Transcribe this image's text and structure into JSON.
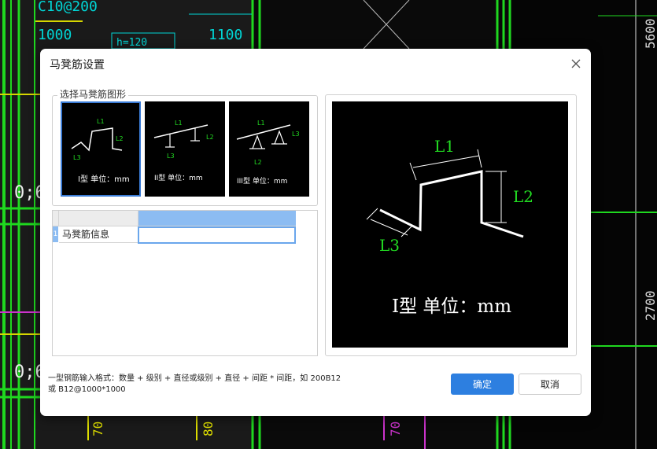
{
  "background": {
    "labels": [
      "C10@200",
      "1000",
      "1100",
      "h=120",
      "5600",
      "2700",
      "0;6",
      "0;6",
      "70",
      "80",
      "70"
    ]
  },
  "dialog": {
    "title": "马凳筋设置",
    "group_label": "选择马凳筋图形",
    "shapes": [
      {
        "caption": "I型 单位：mm",
        "selected": true,
        "labels": [
          "L1",
          "L2",
          "L3"
        ]
      },
      {
        "caption": "II型 单位：mm",
        "selected": false,
        "labels": [
          "L1",
          "L2",
          "L3"
        ]
      },
      {
        "caption": "III型 单位：mm",
        "selected": false,
        "labels": [
          "L1",
          "L2",
          "L3"
        ]
      }
    ],
    "grid": {
      "row_number": "1",
      "row_label": "马凳筋信息",
      "value": ""
    },
    "preview": {
      "caption": "I型 单位：mm",
      "labels": [
        "L1",
        "L2",
        "L3"
      ]
    },
    "hint_line1": "一型钢筋输入格式：数量 + 级别 + 直径或级别 + 直径 + 间距 * 间距，如 200B12",
    "hint_line2": "或 B12@1000*1000",
    "ok_label": "确定",
    "cancel_label": "取消"
  },
  "colors": {
    "cad_green": "#22dd22",
    "cad_cyan": "#00d5d5",
    "accent": "#2d7fe0"
  }
}
